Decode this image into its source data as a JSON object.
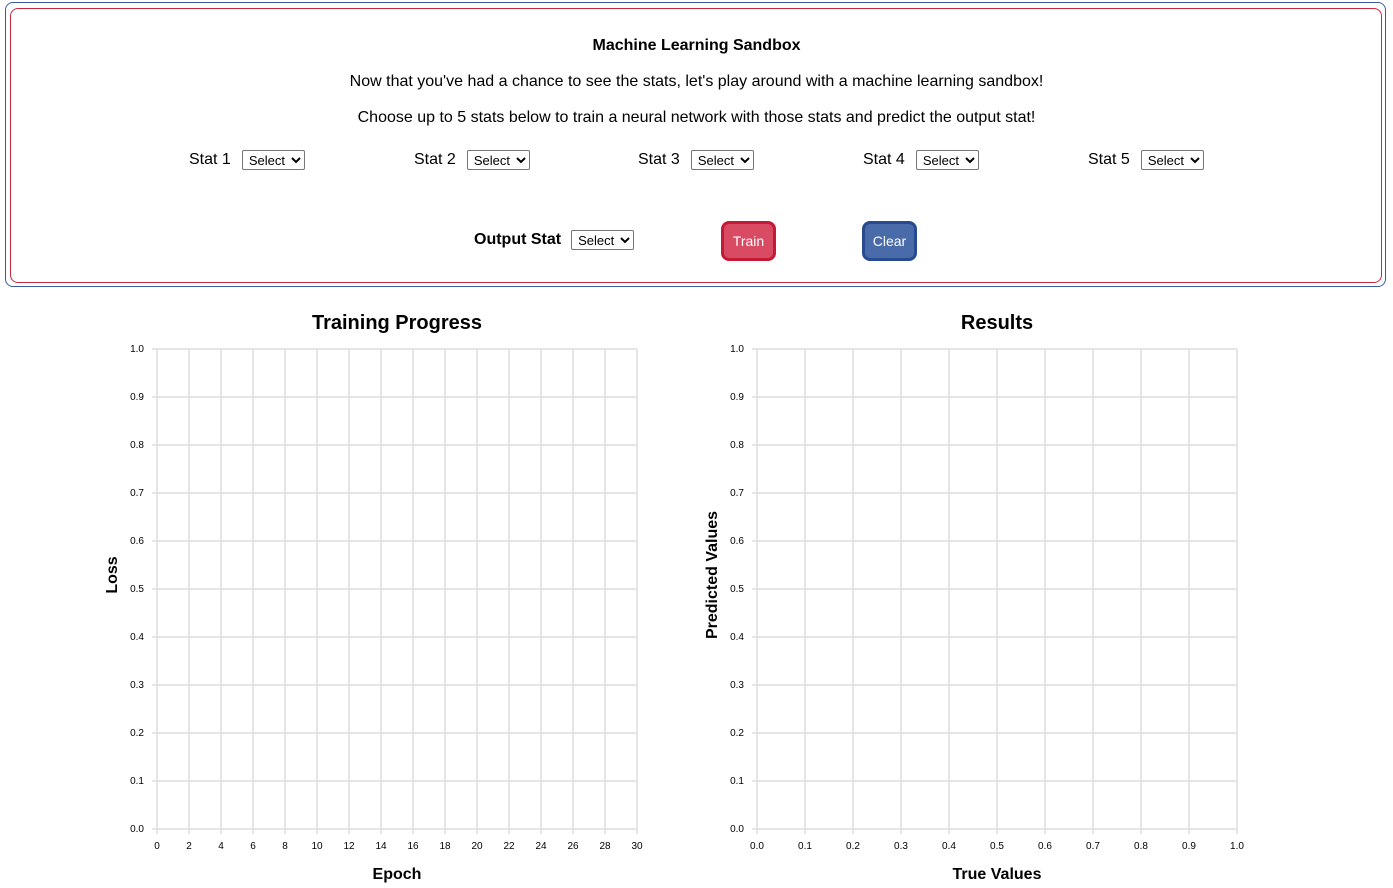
{
  "panel": {
    "title": "Machine Learning Sandbox",
    "line1": "Now that you've had a chance to see the stats, let's play around with a machine learning sandbox!",
    "line2": "Choose up to 5 stats below to train a neural network with those stats and predict the output stat!"
  },
  "stats": [
    {
      "label": "Stat 1",
      "value": "Select"
    },
    {
      "label": "Stat 2",
      "value": "Select"
    },
    {
      "label": "Stat 3",
      "value": "Select"
    },
    {
      "label": "Stat 4",
      "value": "Select"
    },
    {
      "label": "Stat 5",
      "value": "Select"
    }
  ],
  "output": {
    "label": "Output Stat",
    "value": "Select"
  },
  "buttons": {
    "train": "Train",
    "clear": "Clear"
  },
  "colors": {
    "train_fill": "#d94a63",
    "clear_fill": "#4a6ba9",
    "grid": "#dddddd"
  },
  "chart_data": [
    {
      "type": "line",
      "title": "Training Progress",
      "xlabel": "Epoch",
      "ylabel": "Loss",
      "xlim": [
        0,
        30
      ],
      "ylim": [
        0,
        1
      ],
      "xticks": [
        "0",
        "2",
        "4",
        "6",
        "8",
        "10",
        "12",
        "14",
        "16",
        "18",
        "20",
        "22",
        "24",
        "26",
        "28",
        "30"
      ],
      "yticks": [
        "0.0",
        "0.1",
        "0.2",
        "0.3",
        "0.4",
        "0.5",
        "0.6",
        "0.7",
        "0.8",
        "0.9",
        "1.0"
      ],
      "grid": true,
      "series": []
    },
    {
      "type": "scatter",
      "title": "Results",
      "xlabel": "True Values",
      "ylabel": "Predicted Values",
      "xlim": [
        0,
        1
      ],
      "ylim": [
        0,
        1
      ],
      "xticks": [
        "0.0",
        "0.1",
        "0.2",
        "0.3",
        "0.4",
        "0.5",
        "0.6",
        "0.7",
        "0.8",
        "0.9",
        "1.0"
      ],
      "yticks": [
        "0.0",
        "0.1",
        "0.2",
        "0.3",
        "0.4",
        "0.5",
        "0.6",
        "0.7",
        "0.8",
        "0.9",
        "1.0"
      ],
      "grid": true,
      "series": []
    }
  ]
}
